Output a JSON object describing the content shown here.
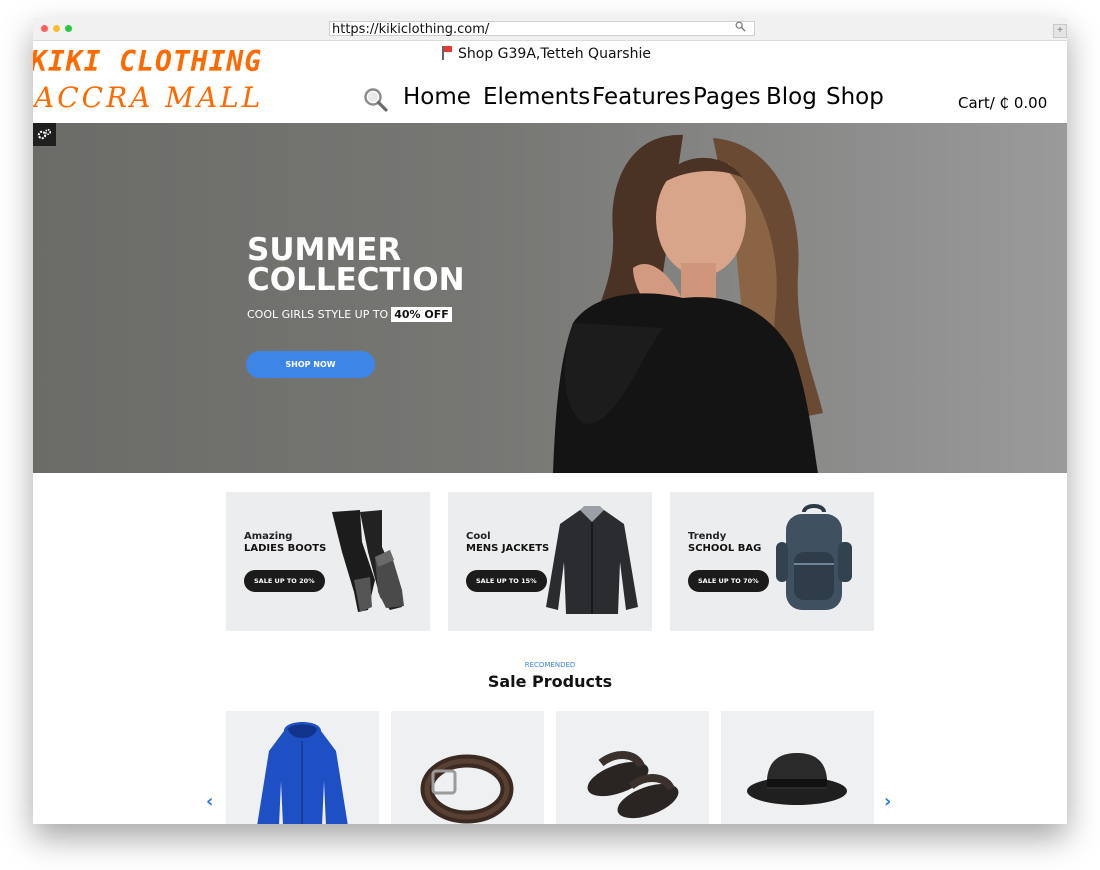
{
  "browser": {
    "url": "https://kikiclothing.com/",
    "plus_label": "+"
  },
  "brand": {
    "line1": "KIKI CLOTHING",
    "line2": "ACCRA MALL",
    "color": "#ff6a00"
  },
  "header": {
    "address": "Shop G39A,Tetteh Quarshie",
    "nav": [
      "Home",
      "Elements",
      "Features",
      "Pages",
      "Blog",
      "Shop"
    ],
    "cart": "Cart/ ₵ 0.00"
  },
  "hero": {
    "title_line1": "SUMMER",
    "title_line2": "COLLECTION",
    "subtitle": "COOL GIRLS STYLE UP TO",
    "discount": "40% OFF",
    "button": "SHOP NOW",
    "accent": "#3d86e8"
  },
  "promos": [
    {
      "small": "Amazing",
      "big": "LADIES BOOTS",
      "button": "SALE UP TO 20%",
      "icon": "boots-image"
    },
    {
      "small": "Cool",
      "big": "MENS JACKETS",
      "button": "SALE UP TO 15%",
      "icon": "jacket-image"
    },
    {
      "small": "Trendy",
      "big": "SCHOOL BAG",
      "button": "SALE UP TO 70%",
      "icon": "backpack-image"
    }
  ],
  "sale": {
    "eyebrow": "RECOMENDED",
    "title": "Sale Products",
    "products": [
      {
        "icon": "hoodie-image"
      },
      {
        "icon": "belt-image"
      },
      {
        "icon": "sandals-image"
      },
      {
        "icon": "hat-image"
      }
    ],
    "prev_icon": "‹",
    "next_icon": "›"
  }
}
